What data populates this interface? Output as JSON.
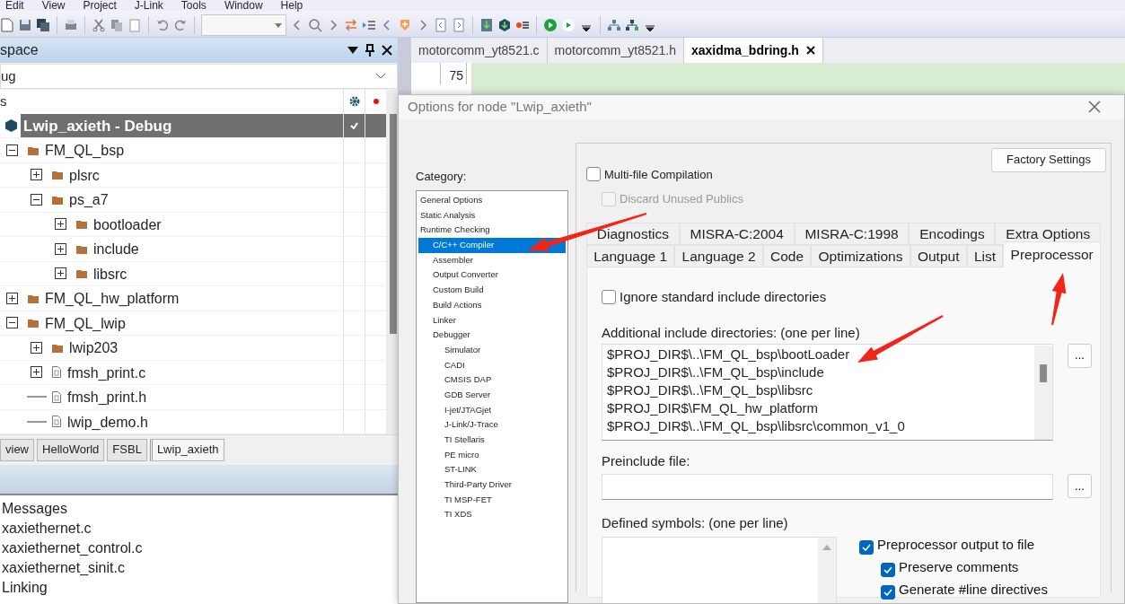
{
  "menu": [
    "Edit",
    "View",
    "Project",
    "J-Link",
    "Tools",
    "Window",
    "Help"
  ],
  "workspace": {
    "title": "space",
    "configuration": "ug",
    "header": "s",
    "tree": [
      {
        "label": "Lwip_axieth - Debug",
        "kind": "project",
        "selected": true,
        "checked": true,
        "children": [
          {
            "label": "FM_QL_bsp",
            "kind": "folder",
            "selected": false,
            "checked": false,
            "expanded": true,
            "children": [
              {
                "label": "plsrc",
                "kind": "folder",
                "selected": false,
                "checked": false,
                "expanded": false
              },
              {
                "label": "ps_a7",
                "kind": "folder",
                "selected": false,
                "checked": false,
                "expanded": true,
                "children": [
                  {
                    "label": "bootloader",
                    "kind": "folder",
                    "selected": false,
                    "checked": false,
                    "expanded": false
                  },
                  {
                    "label": "include",
                    "kind": "folder",
                    "selected": false,
                    "checked": false,
                    "expanded": false
                  },
                  {
                    "label": "libsrc",
                    "kind": "folder",
                    "selected": false,
                    "checked": false,
                    "expanded": false
                  }
                ]
              }
            ]
          },
          {
            "label": "FM_QL_hw_platform",
            "kind": "folder",
            "selected": false,
            "checked": false,
            "expanded": false
          },
          {
            "label": "FM_QL_lwip",
            "kind": "folder",
            "selected": false,
            "checked": false,
            "expanded": true,
            "children": [
              {
                "label": "lwip203",
                "kind": "folder",
                "selected": false,
                "checked": false,
                "expanded": false
              },
              {
                "label": "fmsh_print.c",
                "kind": "file",
                "selected": false,
                "checked": false,
                "expanded": false
              },
              {
                "label": "fmsh_print.h",
                "kind": "file",
                "selected": false,
                "checked": false
              },
              {
                "label": "lwip_demo.h",
                "kind": "file",
                "selected": false,
                "checked": false
              }
            ]
          }
        ]
      }
    ],
    "tabs": [
      {
        "label": "view",
        "selected": false
      },
      {
        "label": "HelloWorld",
        "selected": false
      },
      {
        "label": "FSBL",
        "selected": false
      },
      {
        "label": "Lwip_axieth",
        "selected": true
      }
    ]
  },
  "messages": {
    "header": "Messages",
    "rows": [
      "xaxiethernet.c",
      "xaxiethernet_control.c",
      "xaxiethernet_sinit.c",
      "Linking"
    ]
  },
  "editor": {
    "tabs": [
      {
        "label": "motorcomm_yt8521.c",
        "selected": false
      },
      {
        "label": "motorcomm_yt8521.h",
        "selected": false
      },
      {
        "label": "xaxidma_bdring.h",
        "selected": true
      }
    ],
    "line_number": "75"
  },
  "dialog": {
    "title": "Options for node \"Lwip_axieth\"",
    "category_label": "Category:",
    "categories": [
      {
        "label": "General Options",
        "kind": "general",
        "selected": false
      },
      {
        "label": "Static Analysis",
        "kind": "general",
        "selected": false
      },
      {
        "label": "Runtime Checking",
        "kind": "general",
        "selected": false
      },
      {
        "label": "C/C++ Compiler",
        "kind": "tool",
        "selected": true
      },
      {
        "label": "Assembler",
        "kind": "tool",
        "selected": false
      },
      {
        "label": "Output Converter",
        "kind": "tool",
        "selected": false
      },
      {
        "label": "Custom Build",
        "kind": "tool",
        "selected": false
      },
      {
        "label": "Build Actions",
        "kind": "tool",
        "selected": false
      },
      {
        "label": "Linker",
        "kind": "tool",
        "selected": false
      },
      {
        "label": "Debugger",
        "kind": "tool",
        "selected": false
      },
      {
        "label": "Simulator",
        "kind": "driver",
        "selected": false
      },
      {
        "label": "CADI",
        "kind": "driver",
        "selected": false
      },
      {
        "label": "CMSIS DAP",
        "kind": "driver",
        "selected": false
      },
      {
        "label": "GDB Server",
        "kind": "driver",
        "selected": false
      },
      {
        "label": "I-jet/JTAGjet",
        "kind": "driver",
        "selected": false
      },
      {
        "label": "J-Link/J-Trace",
        "kind": "driver",
        "selected": false
      },
      {
        "label": "TI Stellaris",
        "kind": "driver",
        "selected": false
      },
      {
        "label": "PE micro",
        "kind": "driver",
        "selected": false
      },
      {
        "label": "ST-LINK",
        "kind": "driver",
        "selected": false
      },
      {
        "label": "Third-Party Driver",
        "kind": "driver",
        "selected": false
      },
      {
        "label": "TI MSP-FET",
        "kind": "driver",
        "selected": false
      },
      {
        "label": "TI XDS",
        "kind": "driver",
        "selected": false
      }
    ],
    "factory_button": "Factory Settings",
    "options": [
      {
        "label": "Multi-file Compilation",
        "checked": false,
        "disabled": false,
        "children": [
          {
            "label": "Discard Unused Publics",
            "checked": false,
            "disabled": true
          }
        ]
      }
    ],
    "tab_rows": [
      [
        {
          "label": "Diagnostics",
          "selected": false
        },
        {
          "label": "MISRA-C:2004",
          "selected": false
        },
        {
          "label": "MISRA-C:1998",
          "selected": false
        },
        {
          "label": "Encodings",
          "selected": false
        },
        {
          "label": "Extra Options",
          "selected": false
        }
      ],
      [
        {
          "label": "Language 1",
          "selected": false
        },
        {
          "label": "Language 2",
          "selected": false
        },
        {
          "label": "Code",
          "selected": false
        },
        {
          "label": "Optimizations",
          "selected": false
        },
        {
          "label": "Output",
          "selected": false
        },
        {
          "label": "List",
          "selected": false
        },
        {
          "label": "Preprocessor",
          "selected": true
        }
      ]
    ],
    "preprocessor": {
      "ignore_standard": {
        "label": "Ignore standard include directories",
        "checked": false
      },
      "include_label": "Additional include directories: (one per line)",
      "include_dirs": [
        "$PROJ_DIR$\\..\\FM_QL_bsp\\bootLoader",
        "$PROJ_DIR$\\..\\FM_QL_bsp\\include",
        "$PROJ_DIR$\\..\\FM_QL_bsp\\libsrc",
        "$PROJ_DIR$\\FM_QL_hw_platform",
        "$PROJ_DIR$\\..\\FM_QL_bsp\\libsrc\\common_v1_0"
      ],
      "include_browse": "...",
      "preinclude_label": "Preinclude file:",
      "preinclude_browse": "...",
      "defined_label": "Defined symbols: (one per line)",
      "output_options": [
        {
          "label": "Preprocessor output to file",
          "checked": true,
          "children": [
            {
              "label": "Preserve comments",
              "checked": true
            },
            {
              "label": "Generate #line directives",
              "checked": true
            }
          ]
        }
      ]
    }
  }
}
